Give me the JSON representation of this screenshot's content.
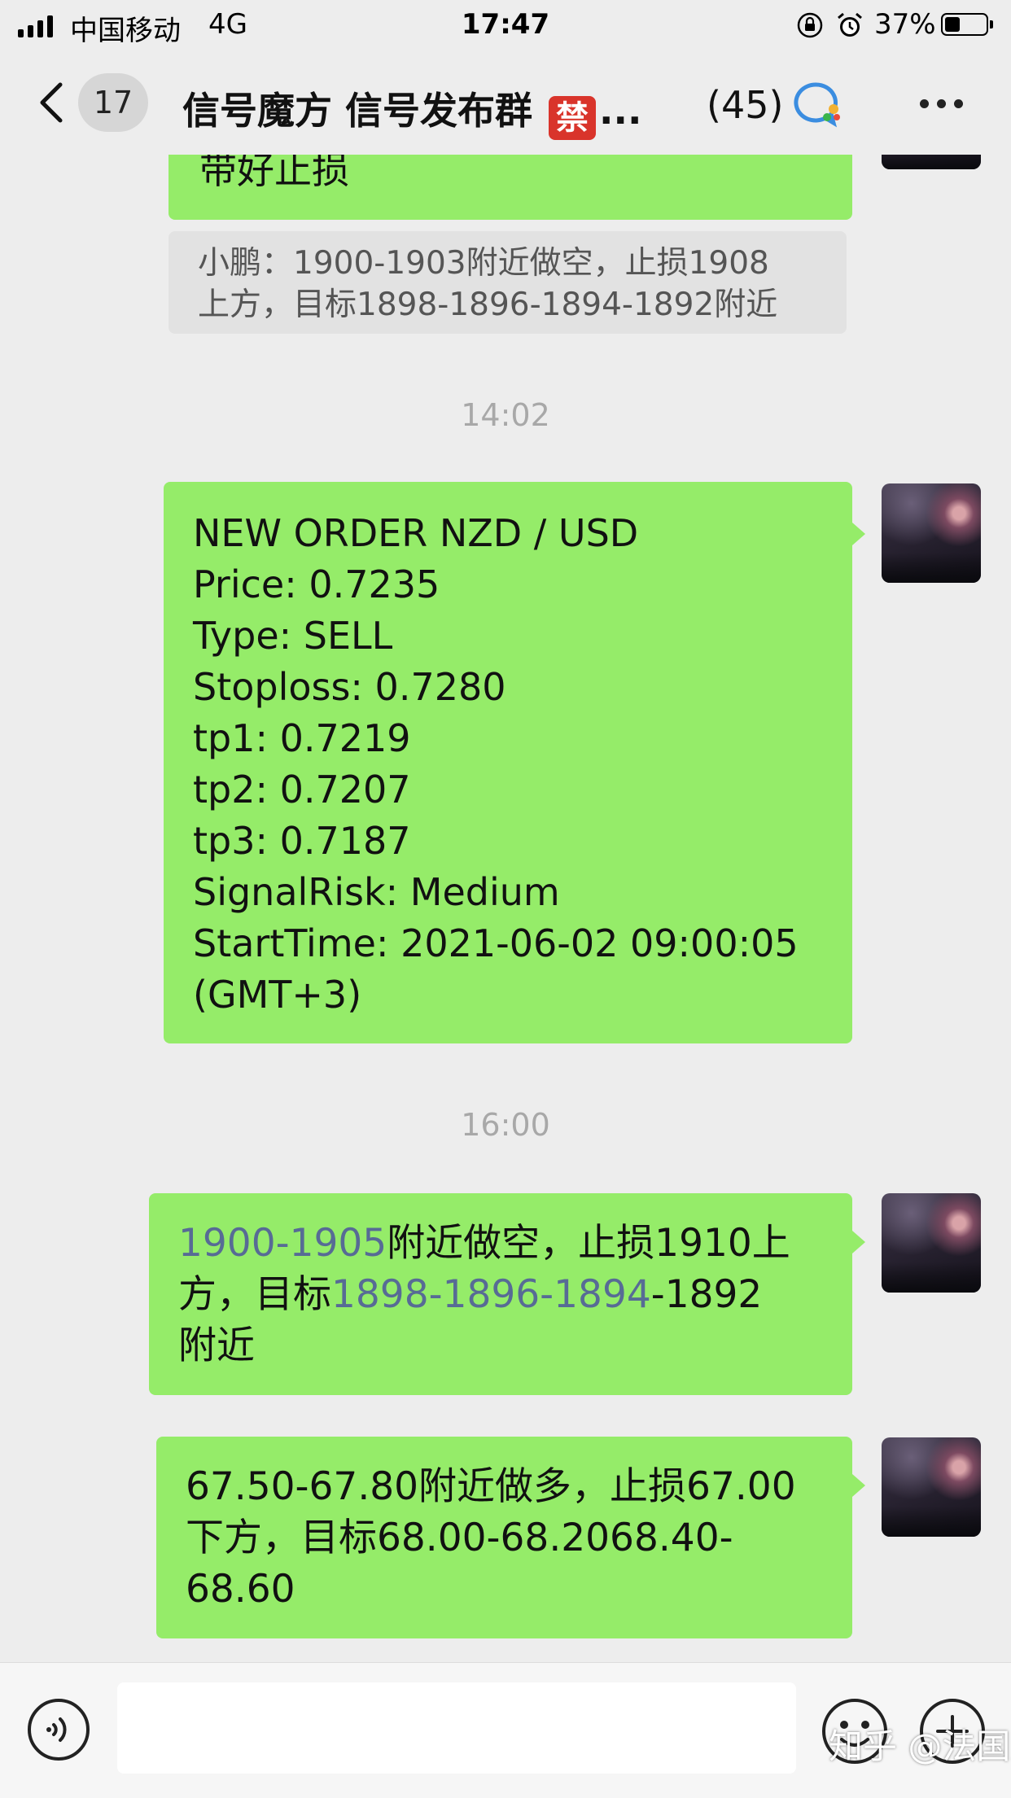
{
  "status_bar": {
    "carrier": "中国移动",
    "network": "4G",
    "time": "17:47",
    "battery_percent": "37%",
    "battery_level": 0.37,
    "icons": [
      "signal-icon",
      "orientation-lock-icon",
      "alarm-icon",
      "battery-icon"
    ]
  },
  "nav": {
    "unread_count": "17",
    "title": "信号魔方 信号发布群",
    "ban_emoji": "禁",
    "ellipsis": "...",
    "member_count": "(45)",
    "icons": [
      "back-icon",
      "group-chat-bubble-icon",
      "more-icon"
    ]
  },
  "messages": {
    "m0": {
      "text": "带好止损"
    },
    "quote": {
      "line1": "小鹏：1900-1903附近做空，止损1908",
      "line2": "上方，目标1898-1896-1894-1892附近"
    },
    "time1": "14:02",
    "m1": {
      "lines": [
        "NEW ORDER NZD / USD",
        "Price: 0.7235",
        "Type: SELL",
        "Stoploss: 0.7280",
        "tp1: 0.7219",
        "tp2: 0.7207",
        "tp3: 0.7187",
        "SignalRisk: Medium",
        "StartTime: 2021-06-02 09:00:05",
        "(GMT+3)"
      ]
    },
    "time2": "16:00",
    "m2": {
      "link1": "1900-1905",
      "part1": "附近做空，止损1910上",
      "part2": "方，目标",
      "link2": "1898-1896-1894",
      "part3": "-1892",
      "part4": "附近"
    },
    "m3": {
      "line1": "67.50-67.80附近做多，止损67.00",
      "line2": "下方，目标68.00-68.2068.40-",
      "line3": "68.60"
    }
  },
  "input_bar": {
    "icons": [
      "voice-icon",
      "emoji-icon",
      "plus-icon"
    ],
    "text_value": ""
  },
  "watermark": "知乎 @法国人",
  "colors": {
    "background": "#ededed",
    "bubble_self": "#95ec69",
    "link": "#576b95",
    "timestamp": "#a8a8a8"
  }
}
